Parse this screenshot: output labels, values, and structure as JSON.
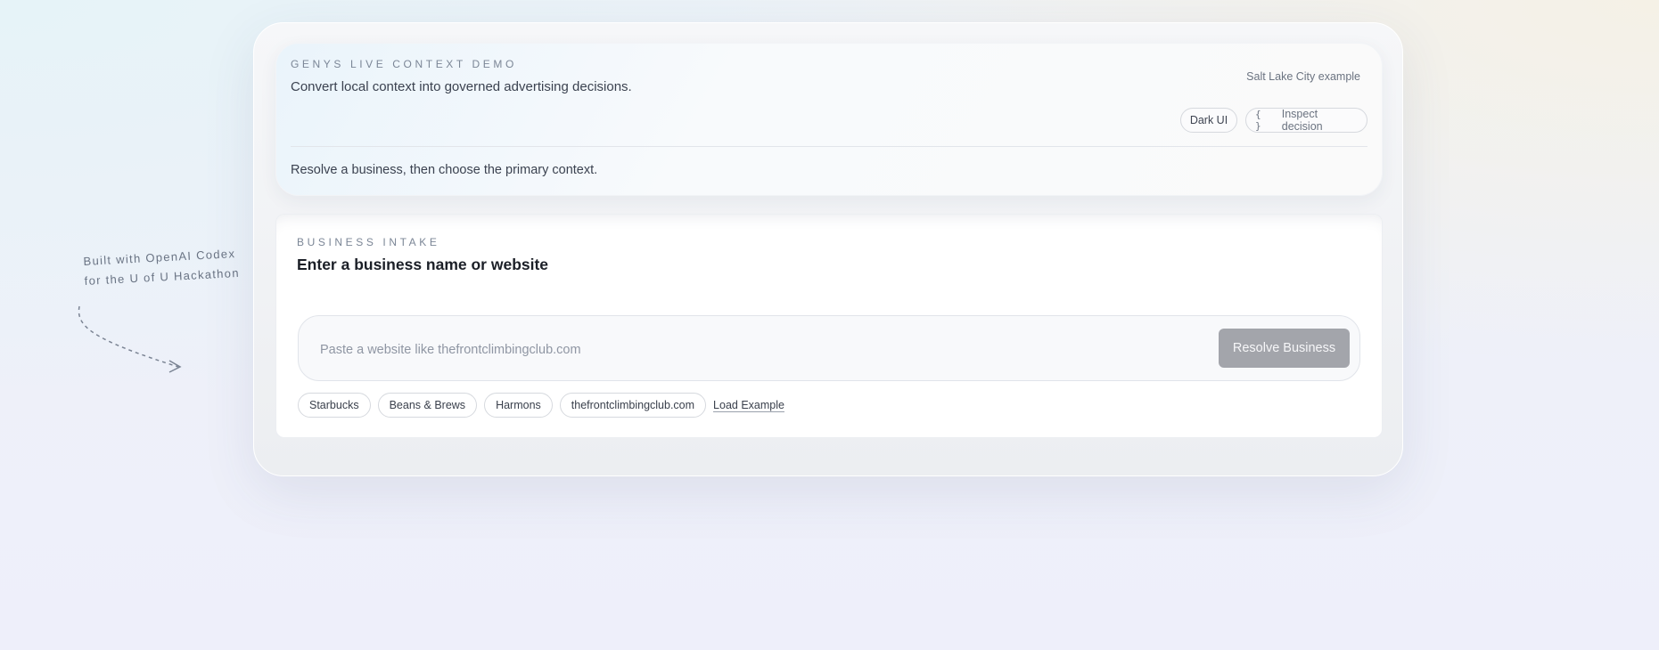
{
  "header": {
    "eyebrow": "GENYS LIVE CONTEXT DEMO",
    "headline": "Convert local context into governed advertising decisions.",
    "example_label": "Salt Lake City example",
    "theme_toggle": "Dark UI",
    "inspect_label": "Inspect decision",
    "inspect_icon": "braces-icon",
    "subline": "Resolve a business, then choose the primary context."
  },
  "intake": {
    "eyebrow": "BUSINESS INTAKE",
    "title": "Enter a business name or website",
    "placeholder": "Paste a website like thefrontclimbingclub.com",
    "value": "",
    "resolve_label": "Resolve Business",
    "suggestions": [
      "Starbucks",
      "Beans & Brews",
      "Harmons",
      "thefrontclimbingclub.com"
    ],
    "load_example": "Load Example"
  },
  "side_note": {
    "line1": "Built with OpenAI Codex",
    "line2": "for the U of U Hackathon"
  },
  "colors": {
    "button_disabled": "#a3a5ab",
    "muted_text": "#7b8696"
  }
}
